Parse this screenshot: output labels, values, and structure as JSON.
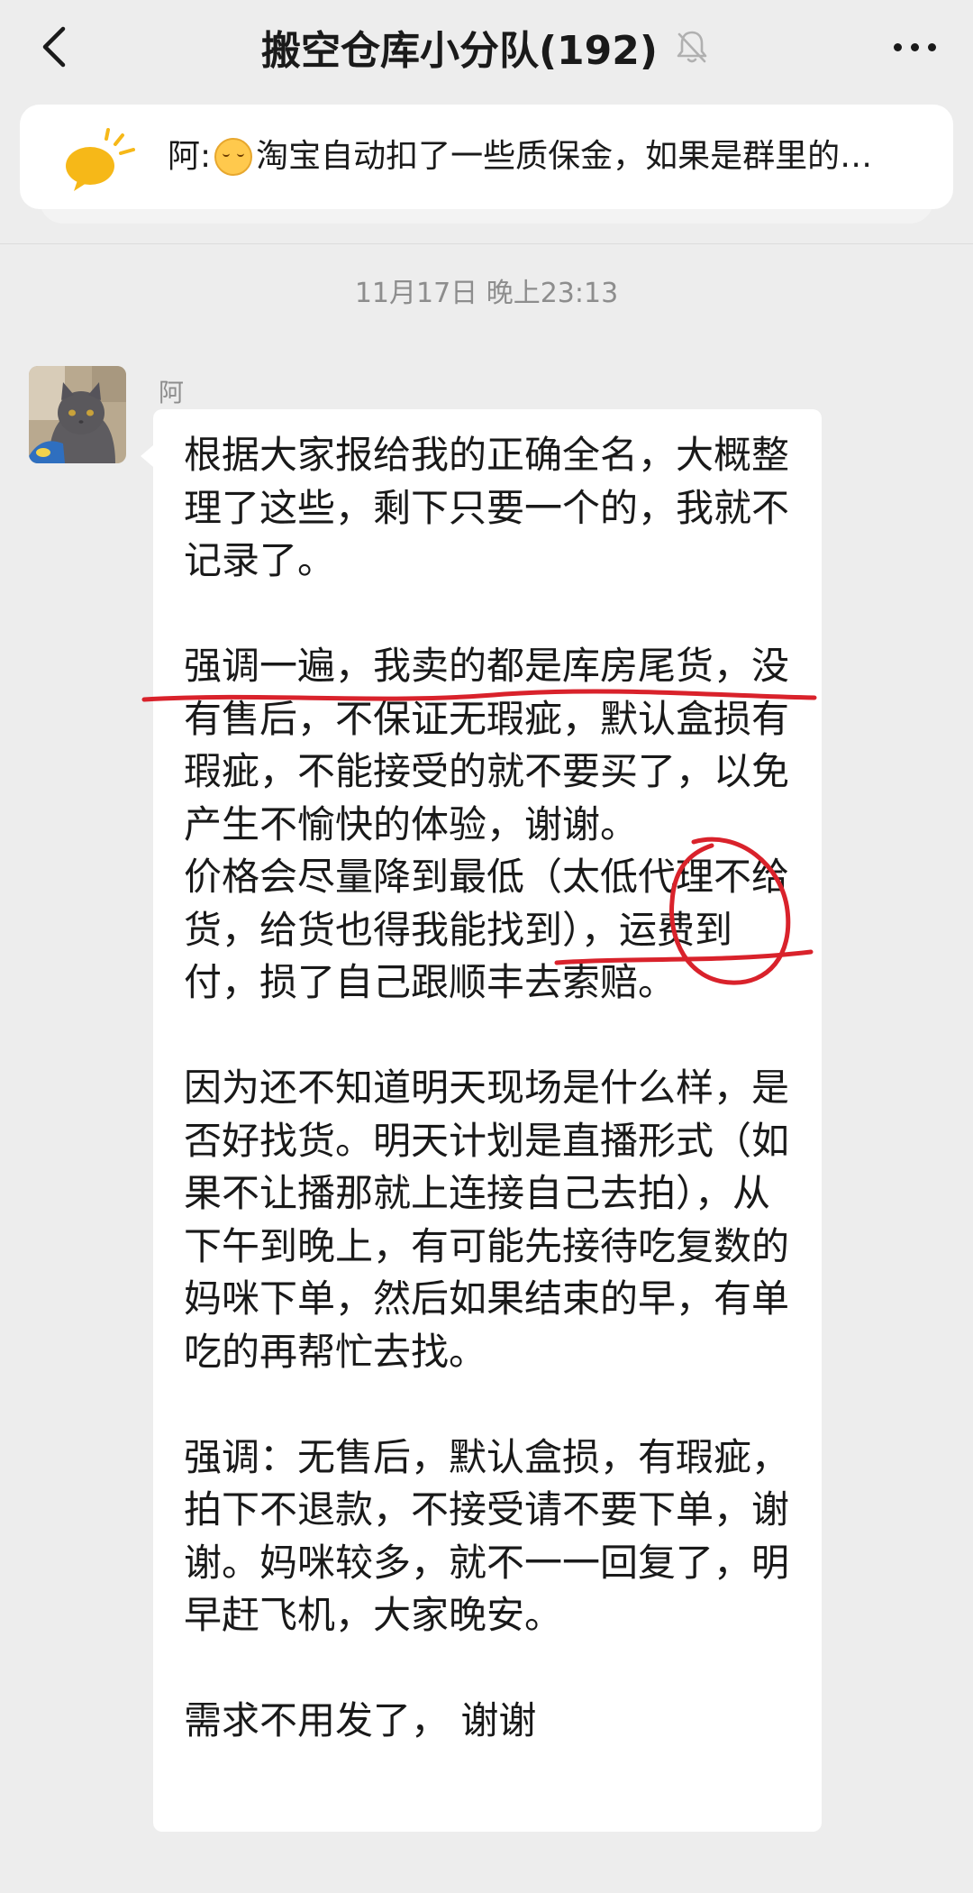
{
  "nav": {
    "title": "搬空仓库小分队(192)",
    "back_icon": "chevron-left-icon",
    "mute_icon": "bell-off-icon",
    "more_icon": "ellipsis-icon"
  },
  "pinned": {
    "icon": "announcement-icon",
    "sender_prefix": "阿:",
    "emoji_icon": "pleading-face-icon",
    "text": "淘宝自动扣了一些质保金，如果是群里的…"
  },
  "chat": {
    "timestamp": "11月17日 晚上23:13",
    "message": {
      "sender": "阿",
      "avatar": "cat-avatar",
      "text": "根据大家报给我的正确全名，大概整理了这些，剩下只要一个的，我就不记录了。\n\n强调一遍，我卖的都是库房尾货，没有售后，不保证无瑕疵，默认盒损有瑕疵，不能接受的就不要买了，以免产生不愉快的体验，谢谢。\n价格会尽量降到最低（太低代理不给货，给货也得我能找到），运费到付，损了自己跟顺丰去索赔。\n\n因为还不知道明天现场是什么样，是否好找货。明天计划是直播形式（如果不让播那就上连接自己去拍），从下午到晚上，有可能先接待吃复数的妈咪下单，然后如果结束的早，有单吃的再帮忙去找。\n\n强调：无售后，默认盒损，有瑕疵，拍下不退款，不接受请不要下单，谢谢。妈咪较多，就不一一回复了，明早赶飞机，大家晚安。\n\n需求不用发了， 谢谢"
    }
  },
  "colors": {
    "background": "#ededed",
    "bubble": "#ffffff",
    "annotation": "#d9222b",
    "secondary_text": "#8d8d8d"
  }
}
